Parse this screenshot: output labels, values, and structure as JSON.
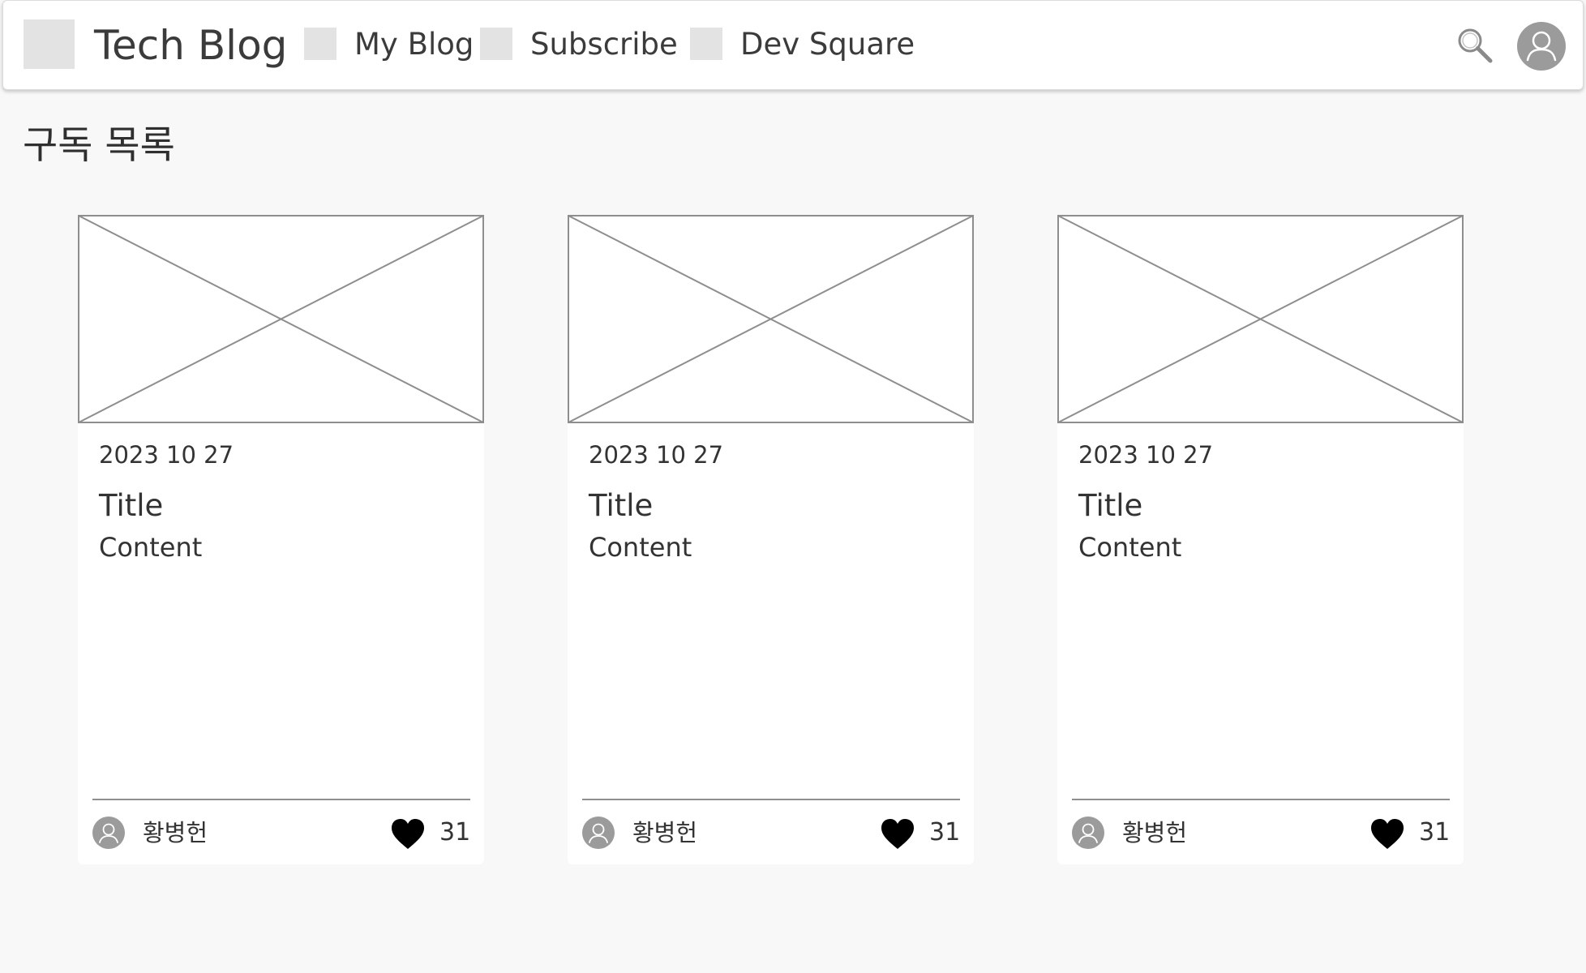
{
  "header": {
    "title": "Tech Blog",
    "logo_icon": "logo-placeholder-icon",
    "nav": [
      {
        "label": "My Blog",
        "icon": "placeholder-icon"
      },
      {
        "label": "Subscribe",
        "icon": "placeholder-icon"
      },
      {
        "label": "Dev Square",
        "icon": "placeholder-icon"
      }
    ],
    "search_icon": "search-icon",
    "avatar_icon": "user-avatar-icon"
  },
  "page": {
    "title": "구독 목록"
  },
  "cards": [
    {
      "date": "2023 10 27",
      "title": "Title",
      "content": "Content",
      "author": "황병헌",
      "likes": "31"
    },
    {
      "date": "2023 10 27",
      "title": "Title",
      "content": "Content",
      "author": "황병헌",
      "likes": "31"
    },
    {
      "date": "2023 10 27",
      "title": "Title",
      "content": "Content",
      "author": "황병헌",
      "likes": "31"
    }
  ],
  "colors": {
    "background": "#f8f8f8",
    "surface": "#ffffff",
    "placeholder": "#e3e3e3",
    "avatar": "#9b9b9b",
    "heart": "#000000",
    "text": "#333333"
  }
}
